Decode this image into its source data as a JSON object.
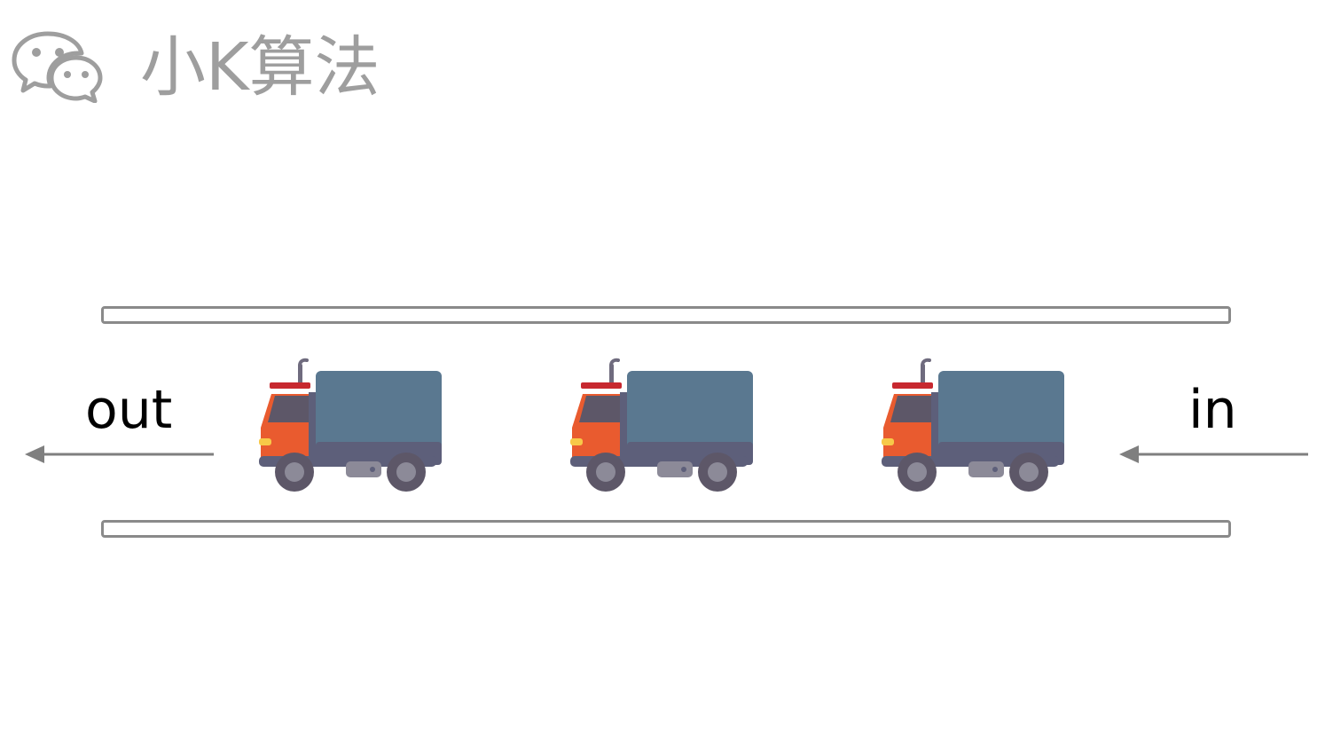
{
  "watermark": {
    "icon": "wechat-icon",
    "text": "小K算法"
  },
  "diagram": {
    "out_label": "out",
    "in_label": "in",
    "trucks": [
      {
        "icon": "truck-icon"
      },
      {
        "icon": "truck-icon"
      },
      {
        "icon": "truck-icon"
      }
    ]
  },
  "colors": {
    "rail": "#8a8a8a",
    "arrow": "#7f7f7f",
    "watermark": "#9e9e9e",
    "truck_cab": "#e95b2f",
    "truck_cargo": "#5a7890",
    "truck_chassis": "#5d5f7a",
    "truck_wheel": "#5d5768"
  }
}
